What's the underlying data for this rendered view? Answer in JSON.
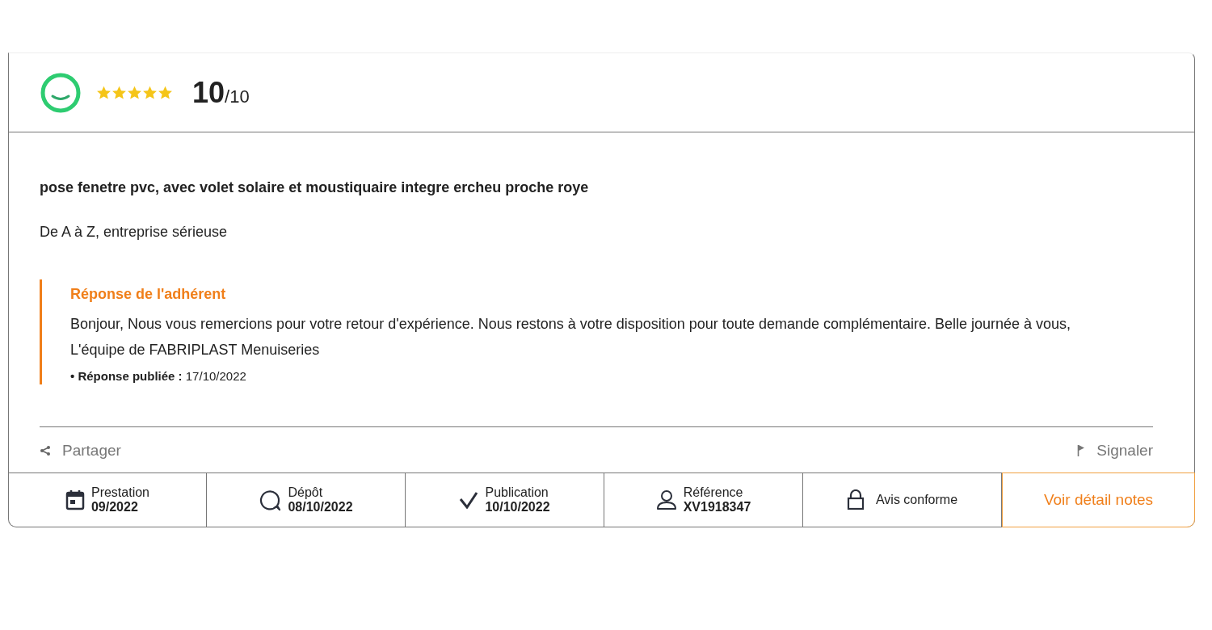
{
  "review": {
    "stars": 5,
    "score": "**10**/10",
    "title": "pose fenetre pvc, avec volet solaire et moustiquaire integre ercheu proche roye",
    "text": "De A à Z, entreprise sérieuse"
  },
  "response": {
    "heading": "Réponse de l'adhérent",
    "text": "Bonjour, Nous vous remercions pour votre retour d'expérience. Nous restons à votre disposition pour toute demande complémentaire. Belle journée à vous, L'équipe de FABRIPLAST Menuiseries",
    "published": "**• Réponse publiée :** 17/10/2022"
  },
  "actions": {
    "share": "Partager",
    "report": "Signaler"
  },
  "footer": [
    {
      "kind": "calendar",
      "label": "Prestation",
      "value": "09/2022"
    },
    {
      "kind": "comment",
      "label": "Dépôt",
      "value": "08/10/2022"
    },
    {
      "kind": "check",
      "label": "Publication",
      "value": "10/10/2022"
    },
    {
      "kind": "user",
      "label": "Référence",
      "value": "XV1918347"
    },
    {
      "kind": "lock",
      "label": "Avis conforme"
    }
  ],
  "details_button": "Voir détail notes"
}
